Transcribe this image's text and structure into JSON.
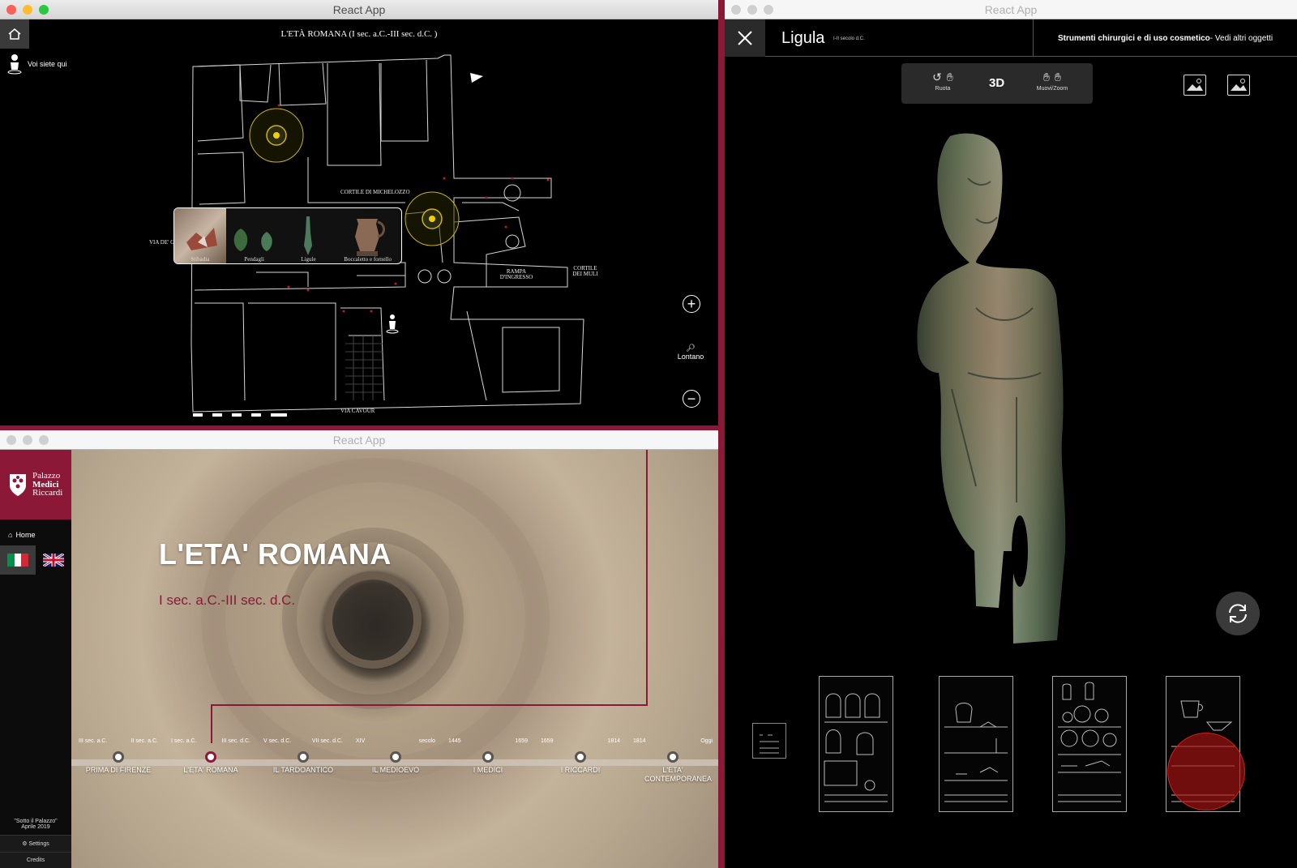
{
  "map_window": {
    "title": "React App",
    "map_title": "L'ETÀ ROMANA (I sec. a.C.-III sec. d.C. )",
    "you_are_here": "Voi siete qui",
    "zoom_label": "Lontano",
    "labels": {
      "cortile_michelozzo": "CORTILE DI MICHELOZZO",
      "rampa": "RAMPA D'INGRESSO",
      "cortile_muli": "CORTILE DEI MULI",
      "via_cavour": "VIA CAVOUR",
      "via_de": "VIA DE' G"
    },
    "popup_items": [
      {
        "label": "Stibadia"
      },
      {
        "label": "Pendagli"
      },
      {
        "label": "Ligule"
      },
      {
        "label": "Boccaletto e fornello"
      }
    ]
  },
  "museum_window": {
    "title": "React App",
    "logo": {
      "line1": "Palazzo",
      "line2": "Medici",
      "line3": "Riccardi"
    },
    "home_label": "Home",
    "footer_note_line1": "\"Sotto il Palazzo\"",
    "footer_note_line2": "Aprile 2019",
    "settings_label": "Settings",
    "credits_label": "Credits",
    "hero_title": "L'ETA' ROMANA",
    "hero_subtitle": "I sec. a.C.-III sec. d.C.",
    "timeline": [
      {
        "from": "III sec. a.C.",
        "to": "II sec. a.C.",
        "name": "PRIMA DI FIRENZE",
        "active": false
      },
      {
        "from": "I sec. a.C.",
        "to": "III sec. d.C.",
        "name": "L'ETA' ROMANA",
        "active": true
      },
      {
        "from": "V sec. d.C.",
        "to": "VII sec. d.C.",
        "name": "IL TARDOANTICO",
        "active": false
      },
      {
        "from": "XIV",
        "to": "secolo",
        "name": "IL MEDIOEVO",
        "active": false
      },
      {
        "from": "1445",
        "to": "1659",
        "name": "I MEDICI",
        "active": false
      },
      {
        "from": "1659",
        "to": "1814",
        "name": "I RICCARDI",
        "active": false
      },
      {
        "from": "1814",
        "to": "Oggi",
        "name": "L'ETA' CONTEMPORANEA",
        "active": false
      }
    ]
  },
  "object_window": {
    "title": "React App",
    "object_name": "Ligula",
    "object_period": "I-II secolo d.C.",
    "category": "Strumenti chirurgici e di uso cosmetico",
    "category_link": " - Vedi altri oggetti",
    "rotate_label": "Ruota",
    "mode_label": "3D",
    "move_zoom_label": "Muovi/Zoom"
  },
  "colors": {
    "accent": "#8c1838",
    "map_circle": "#c9b21c",
    "highlight": "#b31818"
  }
}
